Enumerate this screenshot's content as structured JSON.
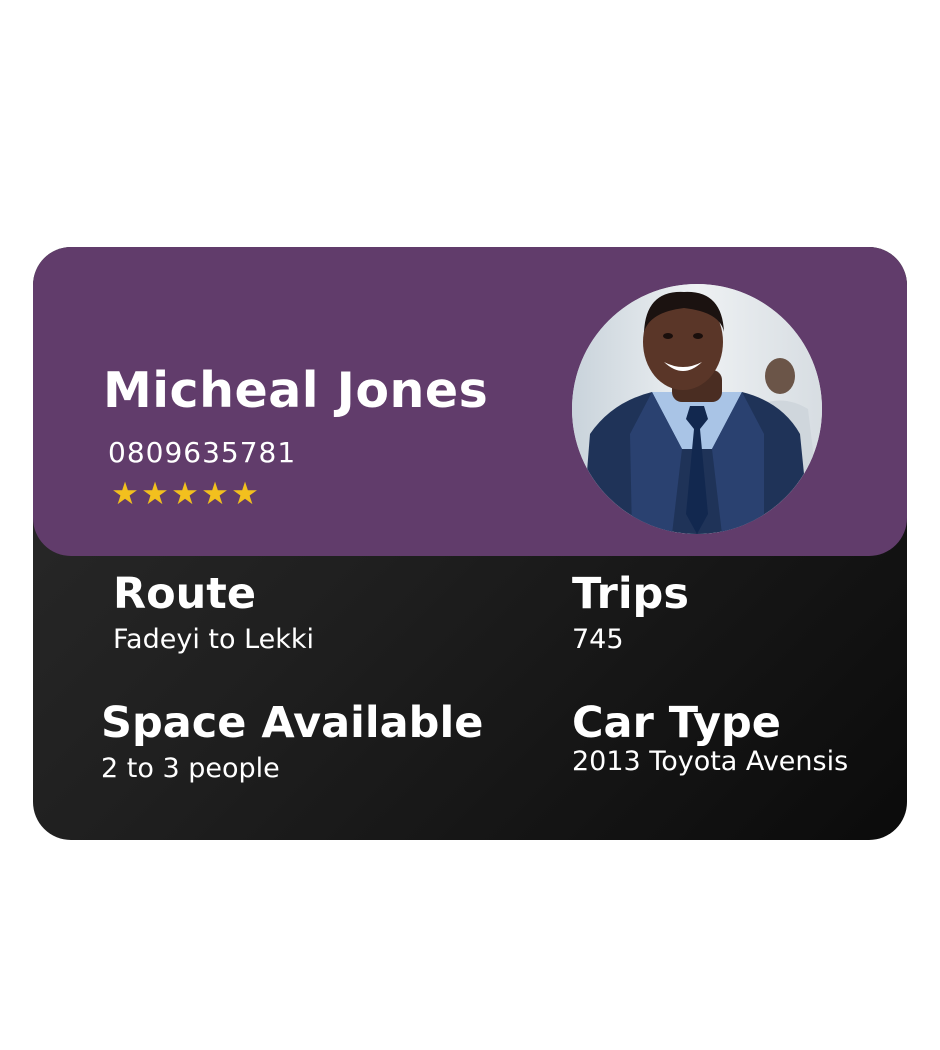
{
  "driver": {
    "name": "Micheal Jones",
    "phone": "0809635781",
    "rating": 5,
    "rating_max": 5,
    "star_glyph": "★",
    "photo_icon": "driver-portrait"
  },
  "details": {
    "route": {
      "label": "Route",
      "value": "Fadeyi to Lekki"
    },
    "trips": {
      "label": "Trips",
      "value": "745"
    },
    "space": {
      "label": "Space Available",
      "value": "2 to 3 people"
    },
    "car": {
      "label": "Car Type",
      "value": "2013 Toyota Avensis"
    }
  },
  "colors": {
    "header": "#613c6b",
    "card_dark": "#1f1f1f",
    "star": "#f2c01e",
    "text": "#ffffff"
  }
}
